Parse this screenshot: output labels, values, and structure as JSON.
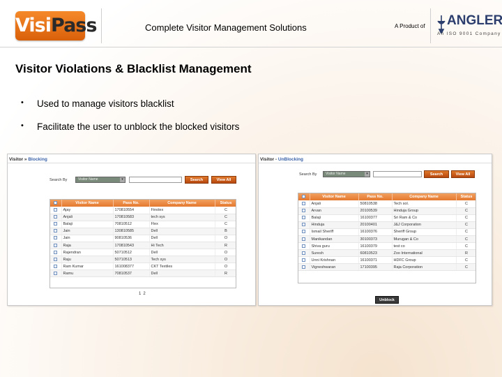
{
  "header": {
    "logo_part1": "Visi",
    "logo_part2": "Pass",
    "tagline": "Complete Visitor Management Solutions",
    "product_of": "A Product of",
    "company": "ANGLER",
    "company_sub": "An ISO 9001 Company"
  },
  "headline": "Visitor Violations & Blacklist Management",
  "bullets": [
    "Used to manage visitors blacklist",
    "Facilitate the user to unblock the blocked visitors"
  ],
  "blocking": {
    "title_prefix": "Visitor",
    "title_sep": " » ",
    "title_crumb": "Blocking",
    "search_by_label": "Search By",
    "search_by_value": "Visitor Name",
    "search_button": "Search",
    "view_all_button": "View All",
    "columns": [
      "",
      "Visitor Name",
      "Pass No.",
      "Company Name",
      "Status"
    ],
    "rows": [
      [
        "Ajay",
        "170810554",
        "Finolex",
        "C"
      ],
      [
        "Anjali",
        "170810583",
        "tech sys",
        "C"
      ],
      [
        "Balaji",
        "70810512",
        "Flex",
        "C"
      ],
      [
        "Jain",
        "130810585",
        "Dell",
        "B"
      ],
      [
        "Jain",
        "90810536",
        "Dell",
        "O"
      ],
      [
        "Raja",
        "170810543",
        "Hi Tech",
        "R"
      ],
      [
        "Rajendran",
        "50710512",
        "Dell",
        "O"
      ],
      [
        "Raju",
        "50710513",
        "Tech sys",
        "O"
      ],
      [
        "Ram Kumar",
        "161008377",
        "CKT Textiles",
        "O"
      ],
      [
        "Ramu",
        "70810537",
        "Dell",
        "R"
      ]
    ],
    "pages": [
      "1",
      "2"
    ]
  },
  "unblocking": {
    "title_prefix": "Visitor",
    "title_sep": " - ",
    "title_crumb": "UnBlocking",
    "search_by_label": "Search By",
    "search_by_value": "Visitor Name",
    "search_button": "Search",
    "view_all_button": "View All",
    "columns": [
      "",
      "Visitor Name",
      "Pass No.",
      "Company Name",
      "Status"
    ],
    "rows": [
      [
        "Anjali",
        "50810538",
        "Tech sol.",
        "C"
      ],
      [
        "Arvan",
        "20100539",
        "Hinduja Group",
        "C"
      ],
      [
        "Balaji",
        "16100377",
        "Sri Ram & Co",
        "C"
      ],
      [
        "Hinduja",
        "20100401",
        "J&J Corporation",
        "C"
      ],
      [
        "Ismail Sheriff",
        "16100376",
        "Sheriff Group",
        "C"
      ],
      [
        "Manikandan",
        "30100373",
        "Murugan & Co",
        "C"
      ],
      [
        "Shiva guru",
        "16100379",
        "test co",
        "C"
      ],
      [
        "Suresh",
        "60810523",
        "Zoo International",
        "R"
      ],
      [
        "Unni Krishnan",
        "16100371",
        "HDFC Group",
        "C"
      ],
      [
        "Vigneshwaran",
        "17100395",
        "Raja Corporation",
        "C"
      ]
    ],
    "unblock_button": "Unblock"
  },
  "colors": {
    "brand_orange": "#e4782e",
    "company_blue": "#2c3e6d"
  }
}
